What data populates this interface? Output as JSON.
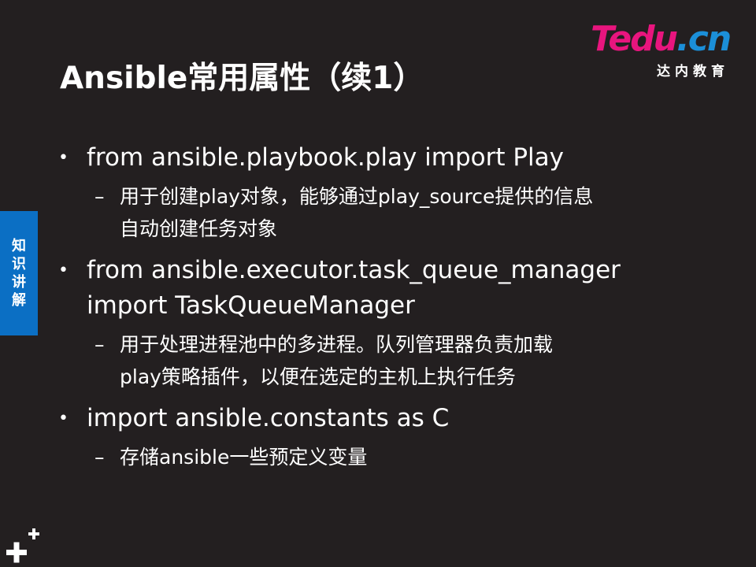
{
  "slide": {
    "title": "Ansible常用属性（续1）",
    "logo": {
      "wordmark_t": "T",
      "wordmark_edu": "edu",
      "wordmark_cn": ".cn",
      "tagline": "达内教育"
    },
    "side_tab": {
      "chars": [
        "知",
        "识",
        "讲",
        "解"
      ]
    },
    "items": [
      {
        "text_lines": [
          "from ansible.playbook.play import Play"
        ],
        "subitems": [
          {
            "text_lines": [
              "用于创建play对象，能够通过play_source提供的信息",
              "自动创建任务对象"
            ]
          }
        ]
      },
      {
        "text_lines": [
          "from ansible.executor.task_queue_manager",
          "import TaskQueueManager"
        ],
        "subitems": [
          {
            "text_lines": [
              "用于处理进程池中的多进程。队列管理器负责加载",
              "play策略插件，以便在选定的主机上执行任务"
            ]
          }
        ]
      },
      {
        "text_lines": [
          "import ansible.constants as C"
        ],
        "subitems": [
          {
            "text_lines": [
              "存储ansible一些预定义变量"
            ]
          }
        ]
      }
    ],
    "bullet_glyph": "•",
    "dash_glyph": "–",
    "icons": {
      "corner": "plus-icon"
    },
    "colors": {
      "background": "#231f20",
      "side_tab": "#0b6fc4",
      "logo_pink": "#e8157e",
      "logo_blue": "#1b8fd8"
    }
  }
}
